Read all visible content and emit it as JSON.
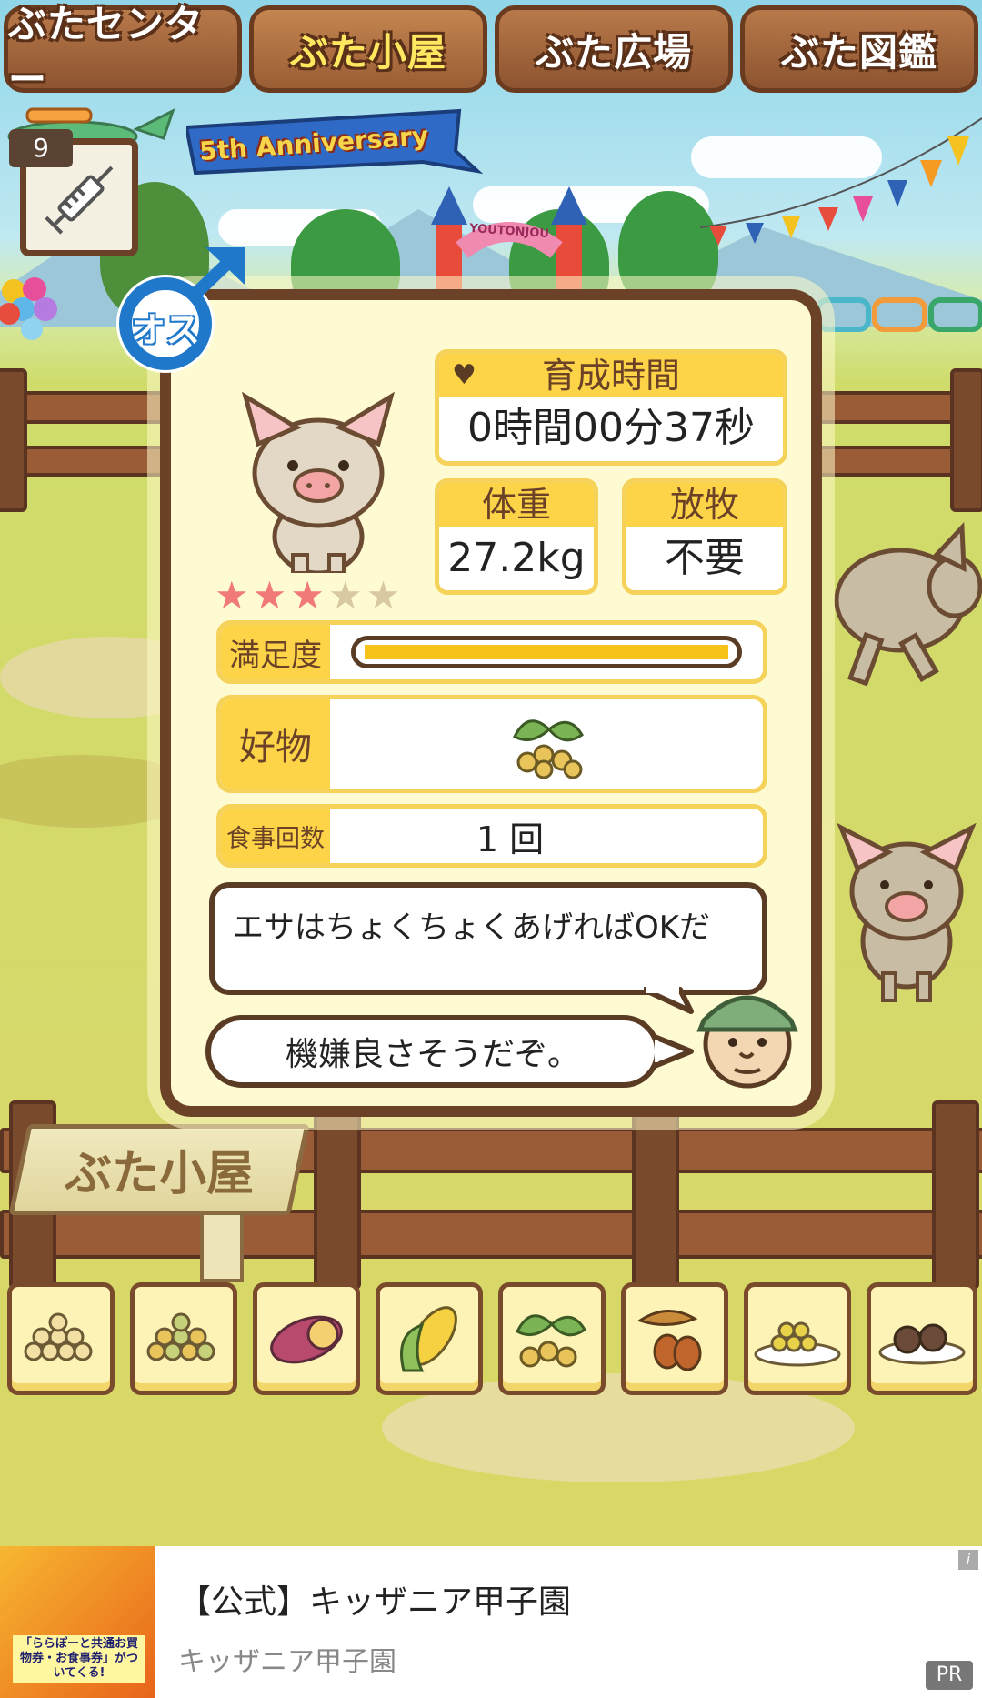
{
  "tabs": [
    {
      "label": "ぶたセンター",
      "active": false
    },
    {
      "label": "ぶた小屋",
      "active": true
    },
    {
      "label": "ぶた広場",
      "active": false
    },
    {
      "label": "ぶた図鑑",
      "active": false
    }
  ],
  "banner": "5th Anniversary",
  "gate_sign": "YOUTONJOU",
  "item": {
    "count": "9",
    "icon": "syringe-icon"
  },
  "gender": {
    "label": "オス",
    "icon": "male-symbol-icon"
  },
  "pig": {
    "stars_total": 5,
    "stars_filled": 3,
    "breeding_time": {
      "label": "育成時間",
      "value": "0時間00分37秒"
    },
    "weight": {
      "label": "体重",
      "value": "27.2kg"
    },
    "grazing": {
      "label": "放牧",
      "value": "不要"
    },
    "satisfaction": {
      "label": "満足度",
      "level": 1.0
    },
    "favorite": {
      "label": "好物",
      "icon": "soybean-icon"
    },
    "meals": {
      "label": "食事回数",
      "value": "1 回"
    }
  },
  "speech": {
    "line1": "エサはちょくちょくあげればOKだ",
    "line2": "機嫌良さそうだぞ。"
  },
  "sign": "ぶた小屋",
  "foods": [
    "beans-icon",
    "mixed-beans-icon",
    "sweet-potato-icon",
    "corn-icon",
    "soybean-icon",
    "acorn-icon",
    "bean-plate-icon",
    "meat-plate-icon"
  ],
  "ad": {
    "title": "【公式】キッザニア甲子園",
    "source": "キッザニア甲子園",
    "badge": "PR",
    "info": "i",
    "thumb_caption": "「ららぽーと共通お買物券・お食事券」がついてくる!"
  },
  "colors": {
    "accent": "#fdd347",
    "frame": "#6b4227",
    "bar": "#f7c21a"
  }
}
